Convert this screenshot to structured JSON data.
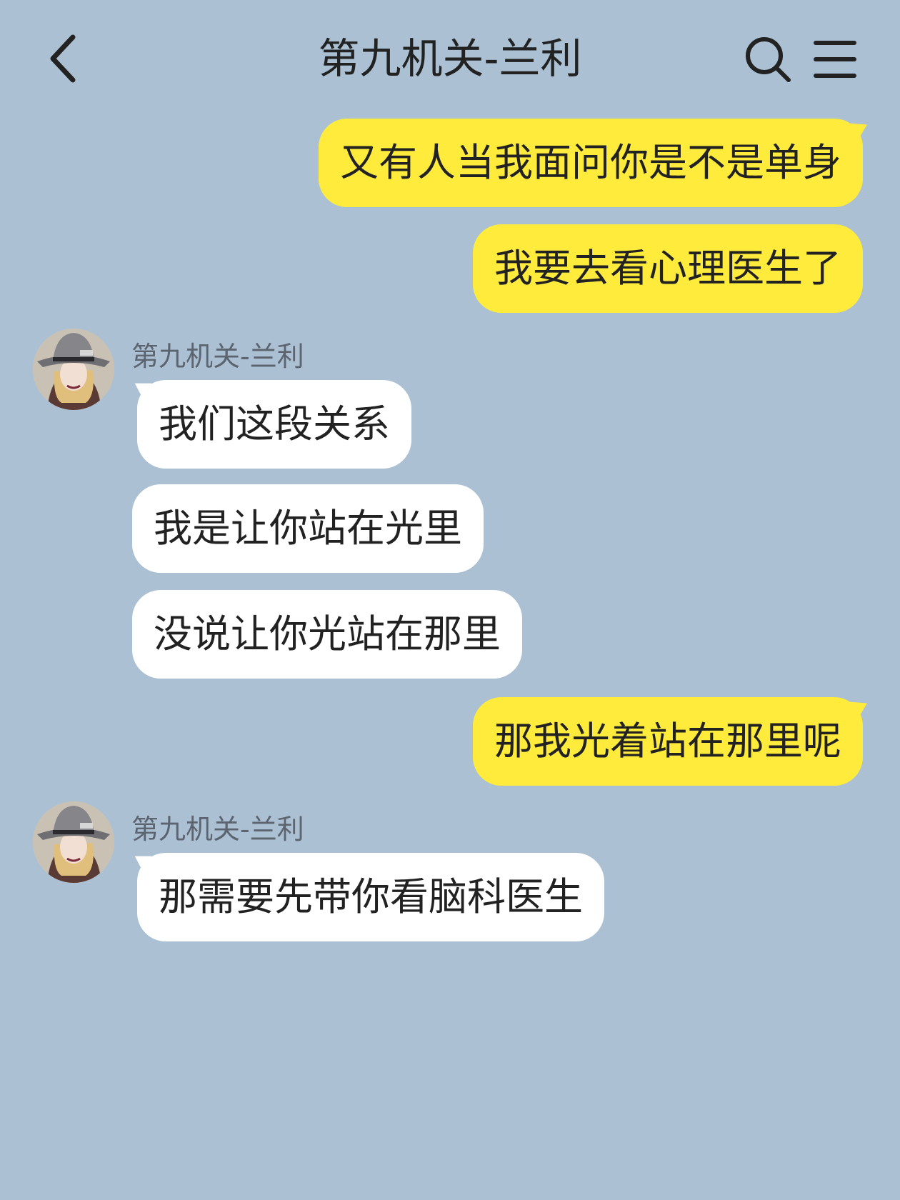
{
  "header": {
    "title": "第九机关-兰利",
    "back_icon": "chevron-left-icon",
    "search_icon": "search-icon",
    "menu_icon": "menu-icon"
  },
  "colors": {
    "background": "#abc0d3",
    "outgoing_bubble": "#ffeb3b",
    "incoming_bubble": "#ffffff"
  },
  "messages": [
    {
      "direction": "out",
      "text": "又有人当我面问你是不是单身"
    },
    {
      "direction": "out",
      "text": "我要去看心理医生了"
    },
    {
      "direction": "in",
      "sender": "第九机关-兰利",
      "text": "我们这段关系"
    },
    {
      "direction": "in",
      "text": "我是让你站在光里"
    },
    {
      "direction": "in",
      "text": "没说让你光站在那里"
    },
    {
      "direction": "out",
      "text": "那我光着站在那里呢"
    },
    {
      "direction": "in",
      "sender": "第九机关-兰利",
      "text": "那需要先带你看脑科医生"
    }
  ]
}
